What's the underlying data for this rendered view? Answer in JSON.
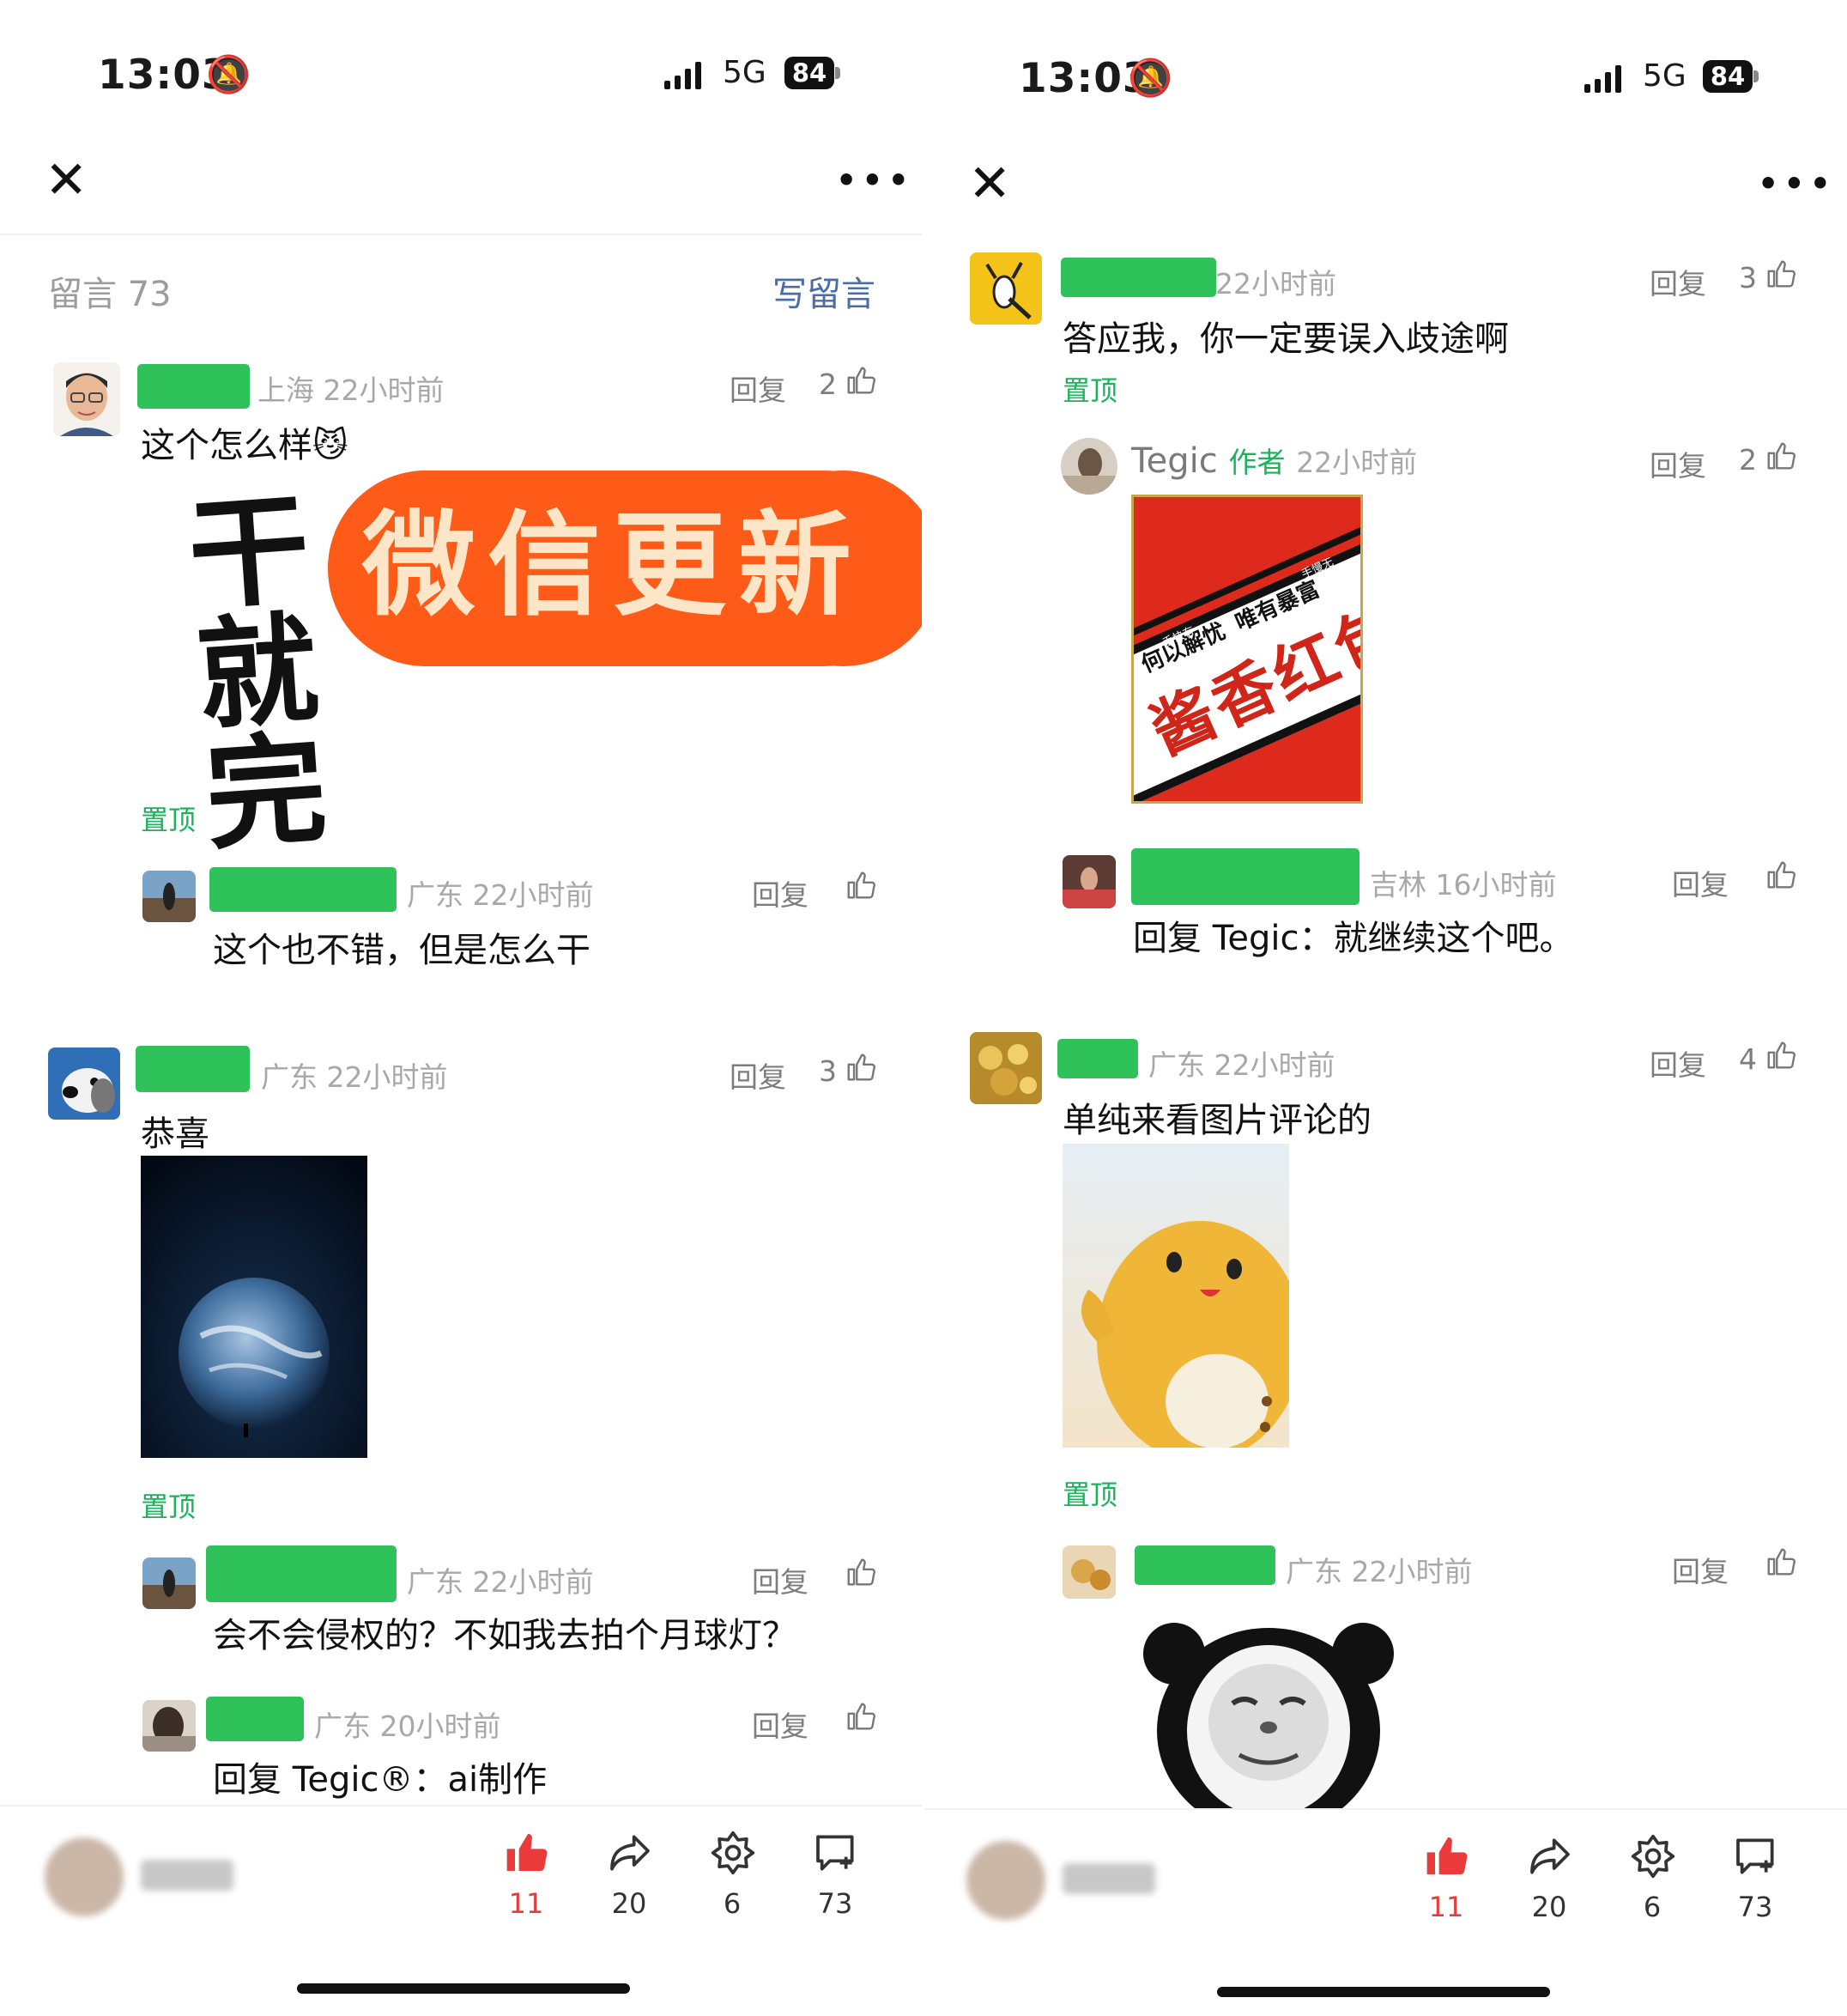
{
  "left": {
    "status": {
      "time": "13:03",
      "network": "5G",
      "battery": "84"
    },
    "header": {
      "title": "留言 73",
      "write": "写留言"
    },
    "comments": [
      {
        "location_time": "上海 22小时前",
        "reply": "回复",
        "likes": "2",
        "text": "这个怎么样",
        "image_text_a": "干就完",
        "image_text_b": "微信更新",
        "pin": "置顶"
      },
      {
        "location_time": "广东 22小时前",
        "reply": "回复",
        "likes": "",
        "text": "这个也不错，但是怎么干"
      },
      {
        "location_time": "广东 22小时前",
        "reply": "回复",
        "likes": "3",
        "text": "恭喜",
        "pin": "置顶"
      },
      {
        "location_time": "广东 22小时前",
        "reply": "回复",
        "likes": "",
        "text": "会不会侵权的？不如我去拍个月球灯？"
      },
      {
        "location_time": "广东 20小时前",
        "reply": "回复",
        "likes": "",
        "text": "回复 Tegic®：ai制作"
      }
    ],
    "bottom": {
      "like": "11",
      "share": "20",
      "star": "6",
      "comment": "73"
    }
  },
  "right": {
    "status": {
      "time": "13:03",
      "network": "5G",
      "battery": "84"
    },
    "comments": [
      {
        "location_time": "22小时前",
        "reply": "回复",
        "likes": "3",
        "text": "答应我，你一定要误入歧途啊",
        "pin": "置顶"
      },
      {
        "name": "Tegic",
        "tag": "作者",
        "time": "22小时前",
        "reply": "回复",
        "likes": "2",
        "label_big": "酱香红包",
        "label_small_a": "何以解忧",
        "label_small_b": "唯有暴富",
        "label_tiny_a": "手快有",
        "label_tiny_b": "手慢无"
      },
      {
        "location_time": "吉林 16小时前",
        "reply": "回复",
        "likes": "",
        "text": "回复 Tegic：就继续这个吧。"
      },
      {
        "location_time": "广东 22小时前",
        "reply": "回复",
        "likes": "4",
        "text": "单纯来看图片评论的",
        "pin": "置顶"
      },
      {
        "location_time": "广东 22小时前",
        "reply": "回复",
        "likes": ""
      }
    ],
    "bottom": {
      "like": "11",
      "share": "20",
      "star": "6",
      "comment": "73"
    }
  },
  "colors": {
    "accent_green": "#2fc25b",
    "link_blue": "#4a6da7",
    "like_red": "#ea3a3a"
  }
}
